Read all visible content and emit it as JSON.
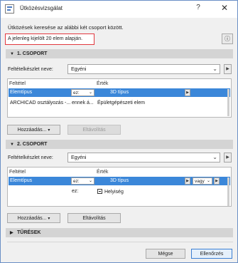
{
  "window": {
    "title": "Ütközésvizsgálat",
    "help_label": "?",
    "close_label": "✕"
  },
  "intro_text": "Ütközések keresése az alábbi két csoport között.",
  "selection_info": "A jelenleg kijelölt 20 elem alapján.",
  "info_button_label": "ⓘ",
  "group1": {
    "header": "1. CSOPORT",
    "criteria_label": "Feltételkészlet neve:",
    "criteria_value": "Egyéni",
    "col_condition": "Feltétel",
    "col_value": "Érték",
    "rows": [
      {
        "condition": "Elemtípus",
        "operator": "ez:",
        "value": "3D típus",
        "selected": true
      },
      {
        "condition": "ARCHICAD osztályozás -...",
        "operator": "ennek á...",
        "value": "Épületgépészeti elem",
        "selected": false
      }
    ],
    "add_button": "Hozzáadás...",
    "remove_button": "Eltávolítás"
  },
  "group2": {
    "header": "2. CSOPORT",
    "criteria_label": "Feltételkészlet neve:",
    "criteria_value": "Egyéni",
    "col_condition": "Feltétel",
    "col_value": "Érték",
    "rows": [
      {
        "condition": "Elemtípus",
        "operator": "ez:",
        "value": "3D típus",
        "logic": "vagy",
        "selected": true
      },
      {
        "condition": "",
        "operator": "ez:",
        "value": "Helyiség",
        "logic": "",
        "selected": false
      }
    ],
    "add_button": "Hozzáadás...",
    "remove_button": "Eltávolítás"
  },
  "tolerances_header": "TŰRÉSEK",
  "footer": {
    "cancel_button": "Mégse",
    "check_button": "Ellenőrzés"
  },
  "colors": {
    "selection": "#3b87d9",
    "highlight_border": "#e2383f",
    "primary_border": "#3b7fd3"
  }
}
